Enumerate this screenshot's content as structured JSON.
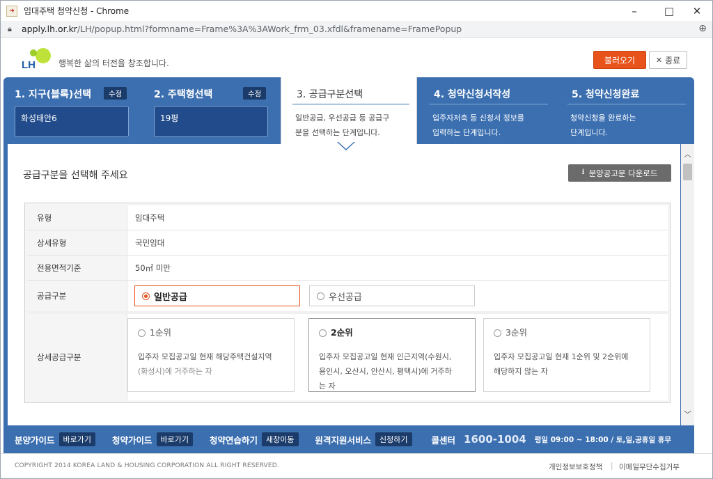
{
  "window": {
    "title": "임대주택 청약신청 - Chrome",
    "minimize": "–",
    "maximize": "□",
    "close": "✕"
  },
  "address": {
    "host": "apply.lh.or.kr",
    "path": "/LH/popup.html?formname=Frame%3A%3AWork_frm_03.xfdl&framename=FramePopup"
  },
  "header": {
    "logo": "LH",
    "slogan": "행복한 삶의 터전을 창조합니다.",
    "load_button": "불러오기",
    "close_button": "종료"
  },
  "steps": [
    {
      "title": "1. 지구(블록)선택",
      "edit": "수정",
      "value": "화성태안6"
    },
    {
      "title": "2. 주택형선택",
      "edit": "수정",
      "value": "19평"
    },
    {
      "title": "3. 공급구분선택",
      "desc1": "일반공급, 우선공급 등 공급구",
      "desc2": "분을 선택하는 단계입니다."
    },
    {
      "title": "4. 청약신청서작성",
      "desc1": "입주자저축 등 신청서 정보를",
      "desc2": "입력하는 단계입니다."
    },
    {
      "title": "5. 청약신청완료",
      "desc1": "청약신청을 완료하는",
      "desc2": "단계입니다."
    }
  ],
  "main": {
    "section_title": "공급구분을 선택해 주세요",
    "download_button": "분양공고문 다운로드",
    "rows": [
      {
        "label": "유형",
        "value": "임대주택"
      },
      {
        "label": "상세유형",
        "value": "국민임대"
      },
      {
        "label": "전용면적기준",
        "value": "50㎡ 미만"
      }
    ],
    "supply": {
      "label": "공급구분",
      "options": [
        "일반공급",
        "우선공급"
      ],
      "selected": "일반공급"
    },
    "detail": {
      "label": "상세공급구분",
      "cards": [
        {
          "title": "1순위",
          "line1": "입주자 모집공고일 현재 해당주택건설지역",
          "line2": "(화성시)에 거주하는 자"
        },
        {
          "title": "2순위",
          "line1": "입주자 모집공고일 현재 인근지역(수원시,",
          "line2": "용인시, 오산시, 안산시, 평택시)에 거주하",
          "line3": "는 자"
        },
        {
          "title": "3순위",
          "line1": "입주자 모집공고일 현재 1순위 및 2순위에",
          "line2": "해당하지 않는 자"
        }
      ]
    }
  },
  "footer": {
    "items": [
      {
        "label": "분양가이드",
        "go": "바로가기"
      },
      {
        "label": "청약가이드",
        "go": "바로가기"
      },
      {
        "label": "청약연습하기",
        "go": "새창이동"
      },
      {
        "label": "원격지원서비스",
        "go": "신청하기"
      }
    ],
    "call_label": "콜센터",
    "call_number": "1600-1004",
    "hours": "평일 09:00 ~ 18:00 / 토,일,공휴일 휴무"
  },
  "copyright": {
    "text": "COPYRIGHT 2014 KOREA LAND & HOUSING CORPORATION ALL RIGHT RESERVED.",
    "link1": "개인정보보호정책",
    "link2": "이메일무단수집거부"
  },
  "colors": {
    "primary": "#3b6fb0",
    "accent": "#e8531c",
    "dark_navy": "#1b3b6a"
  }
}
